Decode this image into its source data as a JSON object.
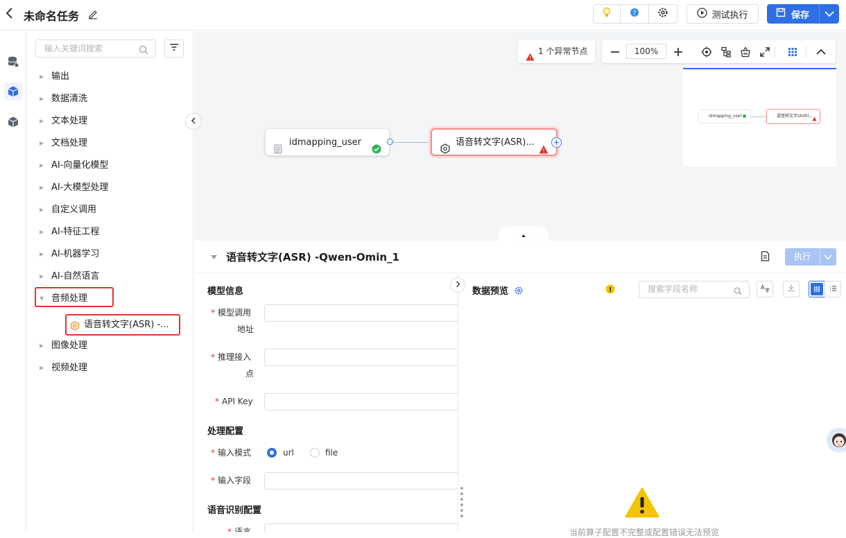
{
  "header": {
    "title": "未命名任务",
    "test_run_label": "测试执行",
    "save_label": "保存"
  },
  "tree": {
    "search_placeholder": "输入关键词搜索",
    "items": [
      {
        "label": "输出"
      },
      {
        "label": "数据清洗"
      },
      {
        "label": "文本处理"
      },
      {
        "label": "文档处理"
      },
      {
        "label": "AI-向量化模型"
      },
      {
        "label": "AI-大模型处理"
      },
      {
        "label": "自定义调用"
      },
      {
        "label": "AI-特征工程"
      },
      {
        "label": "AI-机器学习"
      },
      {
        "label": "AI-自然语言"
      },
      {
        "label": "音频处理"
      },
      {
        "label": "图像处理"
      },
      {
        "label": "视频处理"
      }
    ],
    "audio_child": "语音转文字(ASR) -..."
  },
  "canvas": {
    "alert_text": "1 个异常节点",
    "zoom": "100%",
    "node_source": "idmapping_user",
    "node_asr": "语音转文字(ASR)...",
    "minimap_source": "idmapping_user",
    "minimap_asr": "语音转文字(ASR)..."
  },
  "detail": {
    "title": "语音转文字(ASR) -Qwen-Omin_1",
    "run_label": "执行",
    "sections": {
      "model": "模型信息",
      "process": "处理配置",
      "speech": "语音识别配置"
    },
    "fields": {
      "model_url_1": "模型调用",
      "model_url_2": "地址",
      "endpoint_1": "推理接入",
      "endpoint_2": "点",
      "api_key": "API Key",
      "input_mode": "输入模式",
      "input_field": "输入字段",
      "language": "语言"
    },
    "radio": {
      "url": "url",
      "file": "file",
      "selected": "url"
    }
  },
  "preview": {
    "title": "数据预览",
    "search_placeholder": "搜索字段名称",
    "empty_text": "当前算子配置不完整或配置错误无法预览"
  },
  "colors": {
    "primary": "#2f6fe4",
    "danger": "#e5322d",
    "success": "#2db55d",
    "warning": "#f5c400"
  }
}
